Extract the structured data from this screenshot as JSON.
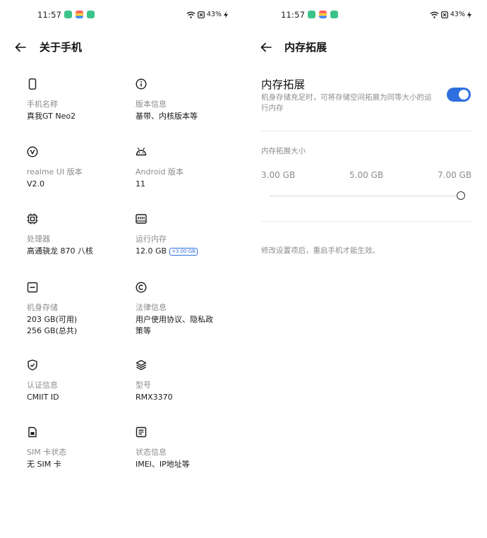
{
  "status_bar": {
    "time": "11:57",
    "battery": "43%",
    "app_icon_colors": [
      "#3cc48a",
      "#ff8a3d",
      "#3cc48a"
    ]
  },
  "left": {
    "title": "关于手机",
    "items": [
      {
        "icon": "phone-icon",
        "label": "手机名称",
        "value": [
          "真我GT Neo2"
        ]
      },
      {
        "icon": "info-icon",
        "label": "版本信息",
        "value": [
          "基带、内核版本等"
        ]
      },
      {
        "icon": "realme-ui-icon",
        "label": "realme UI 版本",
        "value": [
          "V2.0"
        ]
      },
      {
        "icon": "android-icon",
        "label": "Android 版本",
        "value": [
          "11"
        ]
      },
      {
        "icon": "processor-icon",
        "label": "处理器",
        "value": [
          "高通骁龙 870 八核"
        ]
      },
      {
        "icon": "ram-icon",
        "label": "运行内存",
        "value": [
          "12.0 GB"
        ],
        "badge": "+3.00 GB"
      },
      {
        "icon": "storage-icon",
        "label": "机身存储",
        "value": [
          "203 GB(可用)",
          "256 GB(总共)"
        ]
      },
      {
        "icon": "copyright-icon",
        "label": "法律信息",
        "value": [
          "用户使用协议、隐私政",
          "策等"
        ]
      },
      {
        "icon": "certification-icon",
        "label": "认证信息",
        "value": [
          "CMIIT ID"
        ]
      },
      {
        "icon": "layers-icon",
        "label": "型号",
        "value": [
          "RMX3370"
        ]
      },
      {
        "icon": "sim-card-icon",
        "label": "SIM 卡状态",
        "value": [
          "无 SIM 卡"
        ]
      },
      {
        "icon": "status-info-icon",
        "label": "状态信息",
        "value": [
          "IMEI、IP地址等"
        ]
      }
    ]
  },
  "right": {
    "title": "内存拓展",
    "setting": {
      "title": "内存拓展",
      "description": "机身存储充足时，可将存储空间拓展为同等大小的运行内存",
      "enabled": true
    },
    "size_section": {
      "label": "内存拓展大小",
      "options": [
        "3.00 GB",
        "5.00 GB",
        "7.00 GB"
      ],
      "selected": "7.00 GB"
    },
    "footnote": "修改设置项后，重启手机才能生效。"
  },
  "colors": {
    "accent": "#2f6fe0",
    "secondary_text": "#8c8c8c"
  }
}
